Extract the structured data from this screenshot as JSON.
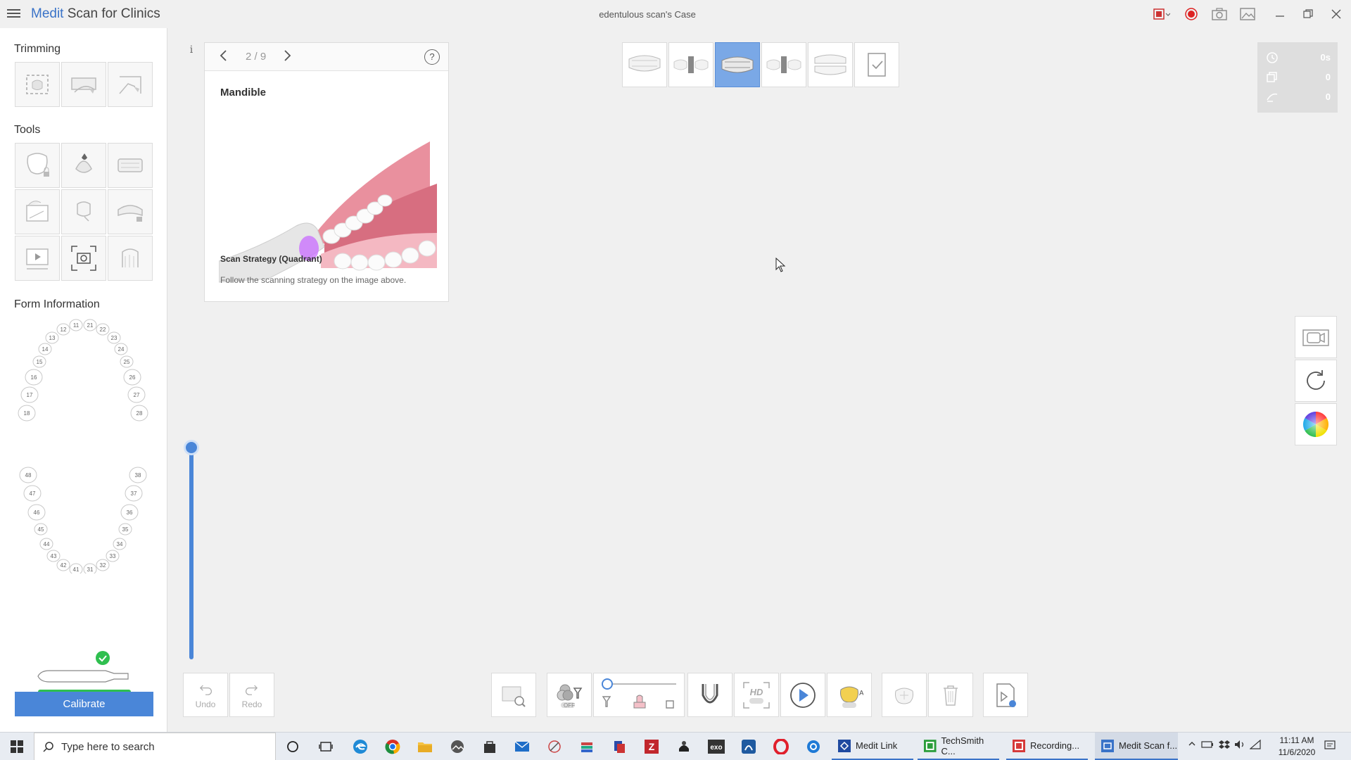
{
  "app": {
    "brand": "Medit",
    "name": " Scan for Clinics",
    "case_title": "edentulous scan's Case"
  },
  "sidebar": {
    "trimming_title": "Trimming",
    "tools_title": "Tools",
    "form_info_title": "Form Information",
    "calibrate_label": "Calibrate",
    "upper_teeth": [
      "11",
      "12",
      "13",
      "14",
      "15",
      "16",
      "17",
      "18",
      "21",
      "22",
      "23",
      "24",
      "25",
      "26",
      "27",
      "28"
    ],
    "lower_teeth": [
      "31",
      "32",
      "33",
      "34",
      "35",
      "36",
      "37",
      "38",
      "41",
      "42",
      "43",
      "44",
      "45",
      "46",
      "47",
      "48"
    ]
  },
  "guide": {
    "page": "2 / 9",
    "help": "?",
    "info": "i",
    "title": "Mandible",
    "strategy": "Scan Strategy (Quadrant)",
    "description": "Follow the scanning strategy on the image above."
  },
  "stages": {
    "active_index": 2,
    "items": [
      "maxilla",
      "maxilla-abutment",
      "mandible",
      "mandible-abutment",
      "occlusion",
      "checklist"
    ]
  },
  "stats": {
    "time": "0s",
    "shots": "0",
    "frames": "0"
  },
  "toolbar": {
    "undo": "Undo",
    "redo": "Redo",
    "off_label": "OFF",
    "hd_label": "HD"
  },
  "taskbar": {
    "search_placeholder": "Type here to search",
    "windows": [
      {
        "label": "Medit Link"
      },
      {
        "label": "TechSmith C..."
      },
      {
        "label": "Recording..."
      },
      {
        "label": "Medit Scan f..."
      }
    ],
    "time": "11:11 AM",
    "date": "11/6/2020"
  },
  "colors": {
    "accent": "#4a86d8",
    "stage_active": "#7aa8e6",
    "status_ok": "#2fbf4f"
  }
}
